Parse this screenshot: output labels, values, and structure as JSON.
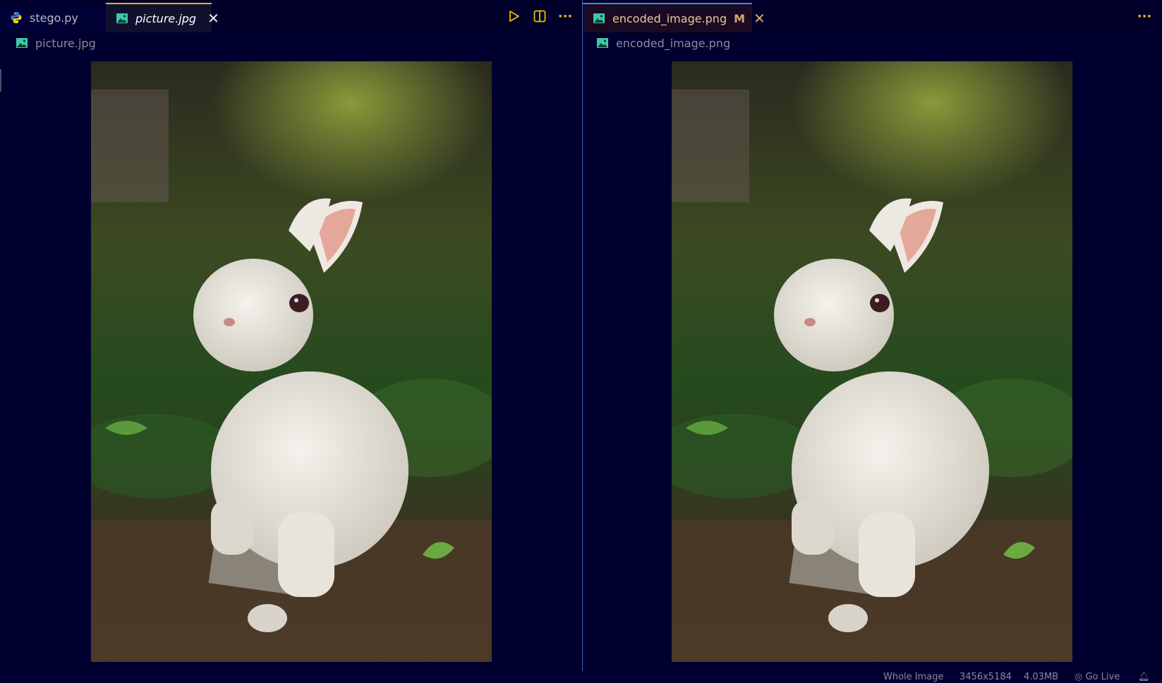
{
  "left_pane": {
    "tabs": [
      {
        "label": "stego.py",
        "icon": "python-icon",
        "active": false
      },
      {
        "label": "picture.jpg",
        "icon": "image-icon",
        "active": true,
        "close": "✕"
      }
    ],
    "actions": [
      {
        "icon": "run-icon",
        "glyph": "▷"
      },
      {
        "icon": "split-editor-icon",
        "glyph": "▥"
      },
      {
        "icon": "more-actions-icon",
        "glyph": "···"
      }
    ],
    "breadcrumb": "picture.jpg"
  },
  "right_pane": {
    "tab": {
      "label": "encoded_image.png",
      "icon": "image-icon",
      "badge": "M",
      "close": "✕"
    },
    "more_glyph": "···",
    "breadcrumb": "encoded_image.png"
  },
  "statusbar": {
    "selection": "Whole Image",
    "dimensions": "3456x5184",
    "size": "4.03MB",
    "go_live": "Go Live"
  },
  "colors": {
    "background": "#00002e",
    "active_tab_accent": "#e8b800",
    "right_tab_accent": "#3a8ee0",
    "modified_badge": "#d4a86a",
    "image_icon": "#3fc9a8"
  }
}
